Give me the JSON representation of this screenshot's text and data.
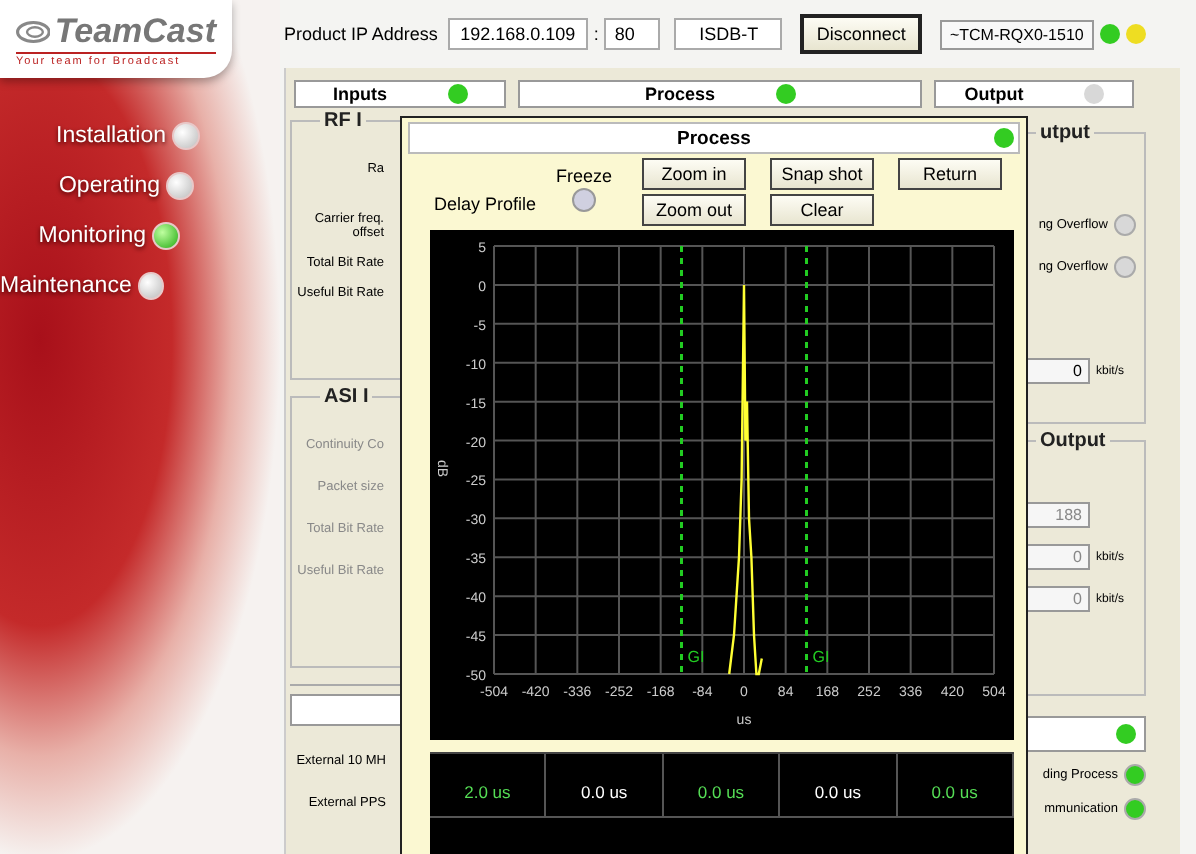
{
  "sidebar": {
    "logo": "TeamCast",
    "tagline": "Your team for Broadcast",
    "items": [
      {
        "label": "Installation",
        "selected": false
      },
      {
        "label": "Operating",
        "selected": false
      },
      {
        "label": "Monitoring",
        "selected": true
      },
      {
        "label": "Maintenance",
        "selected": false
      }
    ]
  },
  "topbar": {
    "ip_label": "Product IP Address",
    "ip": "192.168.0.109",
    "separator": ":",
    "port": "80",
    "standard": "ISDB-T",
    "disconnect": "Disconnect",
    "device": "~TCM-RQX0-1510",
    "indicators": [
      {
        "color": "#33cc22"
      },
      {
        "color": "#eedd22"
      }
    ]
  },
  "headers": [
    {
      "title": "Inputs",
      "color": "#33cc22"
    },
    {
      "title": "Process",
      "color": "#33cc22"
    },
    {
      "title": "Output",
      "color": "#d8d8d8"
    }
  ],
  "rf_group": {
    "title": "RF I",
    "labels": [
      "Ra",
      "Carrier freq. offset",
      "Total Bit Rate",
      "Useful Bit Rate"
    ]
  },
  "asi_group": {
    "title": "ASI I",
    "labels": [
      "Continuity Co",
      "Packet size",
      "Total Bit Rate",
      "Useful Bit Rate"
    ]
  },
  "sync_panel": {
    "labels": [
      "External 10 MH",
      "External PPS"
    ]
  },
  "output_group": {
    "title": "utput",
    "alarms": [
      {
        "label": "ng Overflow",
        "color": "#d8d8d8"
      },
      {
        "label": "ng Overflow",
        "color": "#d8d8d8"
      }
    ],
    "rate": "0",
    "unit": "kbit/s"
  },
  "output_group_2": {
    "title": "Output",
    "fields": [
      {
        "value": "188"
      },
      {
        "value": "0",
        "unit": "kbit/s"
      },
      {
        "value": "0",
        "unit": "kbit/s"
      }
    ]
  },
  "status_panel": {
    "color": "#33cc22",
    "items": [
      {
        "label": "ding Process",
        "color": "#33cc22"
      },
      {
        "label": "mmunication",
        "color": "#33cc22"
      }
    ]
  },
  "dialog": {
    "title": "Process",
    "color": "#33cc22",
    "freeze_label": "Freeze",
    "freeze": false,
    "profile_label": "Delay Profile",
    "buttons": [
      "Zoom in",
      "Zoom out",
      "Snap shot",
      "Clear",
      "Return"
    ],
    "chart_data": {
      "type": "line",
      "xlabel": "us",
      "ylabel": "dB",
      "x": [
        -30,
        -20,
        -10,
        -5,
        0,
        3,
        6,
        10,
        15,
        20,
        25,
        30,
        36
      ],
      "grid": true,
      "series": [
        {
          "color": "#ffff33",
          "values": [
            -50,
            -45,
            -35,
            -25,
            0,
            -20,
            -15,
            -30,
            -35,
            -45,
            -50,
            -50,
            -48
          ]
        }
      ],
      "xlim": [
        -504,
        504
      ],
      "ylim": [
        -50,
        5
      ],
      "xticks": [
        -504,
        -420,
        -336,
        -252,
        -168,
        -84,
        0,
        84,
        168,
        252,
        336,
        420,
        504
      ],
      "yticks": [
        5,
        0,
        -5,
        -10,
        -15,
        -20,
        -25,
        -30,
        -35,
        -40,
        -45,
        -50
      ],
      "ref_lines": [
        {
          "axis": "x",
          "value": -126,
          "label": "GI",
          "color": "#22cc22"
        },
        {
          "axis": "x",
          "value": 126,
          "label": "GI",
          "color": "#22cc22"
        }
      ]
    },
    "cells": [
      {
        "text": "2.0 us",
        "highlighted": true
      },
      {
        "text": "0.0 us",
        "highlighted": false
      },
      {
        "text": "0.0 us",
        "highlighted": true
      },
      {
        "text": "0.0 us",
        "highlighted": false
      },
      {
        "text": "0.0 us",
        "highlighted": true
      }
    ]
  }
}
